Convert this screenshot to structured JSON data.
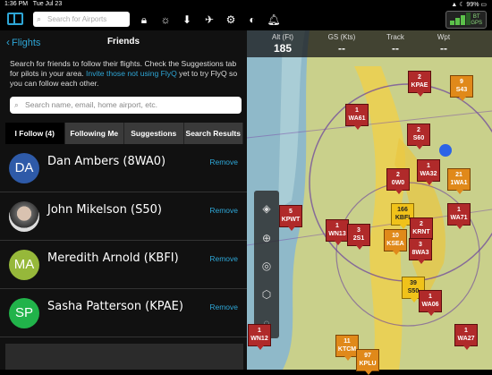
{
  "status": {
    "time": "1:36 PM",
    "date": "Tue Jul 23",
    "battery": "99%"
  },
  "toolbar": {
    "search_placeholder": "Search for Airports",
    "icons": [
      "sidebar-icon",
      "lock-icon",
      "brightness-icon",
      "download-icon",
      "airplane-icon",
      "gear-icon",
      "contrast-icon",
      "bell-icon"
    ],
    "gps_text_1": "BT",
    "gps_text_2": "GPS"
  },
  "panel": {
    "back_label": "Flights",
    "title": "Friends",
    "intro": "Search for friends to follow their flights. Check the Suggestions tab for pilots in your area.",
    "intro_link": "Invite those not using FlyQ",
    "intro_tail": "yet to try FlyQ so you can follow each other.",
    "search_placeholder": "Search name, email, home airport, etc.",
    "tabs": [
      {
        "label": "I Follow (4)",
        "active": true
      },
      {
        "label": "Following Me",
        "active": false
      },
      {
        "label": "Suggestions",
        "active": false
      },
      {
        "label": "Search Results",
        "active": false
      }
    ],
    "friends": [
      {
        "initials": "DA",
        "name": "Dan Ambers (8WA0)",
        "color": "#2e5aa8",
        "remove": "Remove"
      },
      {
        "initials": "",
        "name": "John Mikelson (S50)",
        "color": "#444",
        "remove": "Remove"
      },
      {
        "initials": "MA",
        "name": "Meredith Arnold (KBFI)",
        "color": "#96b83a",
        "remove": "Remove"
      },
      {
        "initials": "SP",
        "name": "Sasha Patterson (KPAE)",
        "color": "#21b34a",
        "remove": "Remove"
      }
    ]
  },
  "map": {
    "info": [
      {
        "label": "Alt (Ft)",
        "value": "185"
      },
      {
        "label": "GS (Kts)",
        "value": "--"
      },
      {
        "label": "Track",
        "value": "--"
      },
      {
        "label": "Wpt",
        "value": "--"
      }
    ],
    "pins": [
      {
        "top": "2",
        "bot": "KPAE",
        "cls": ""
      },
      {
        "top": "9",
        "bot": "S43",
        "cls": "or"
      },
      {
        "top": "1",
        "bot": "WA61",
        "cls": ""
      },
      {
        "top": "2",
        "bot": "S60",
        "cls": ""
      },
      {
        "top": "1",
        "bot": "WA32",
        "cls": ""
      },
      {
        "top": "2",
        "bot": "0W0",
        "cls": ""
      },
      {
        "top": "21",
        "bot": "1WA1",
        "cls": "or"
      },
      {
        "top": "5",
        "bot": "KPWT",
        "cls": ""
      },
      {
        "top": "166",
        "bot": "KBFI",
        "cls": "yl"
      },
      {
        "top": "1",
        "bot": "WA71",
        "cls": ""
      },
      {
        "top": "1",
        "bot": "WN13",
        "cls": ""
      },
      {
        "top": "3",
        "bot": "2S1",
        "cls": ""
      },
      {
        "top": "2",
        "bot": "KRNT",
        "cls": ""
      },
      {
        "top": "10",
        "bot": "KSEA",
        "cls": "or"
      },
      {
        "top": "3",
        "bot": "8WA3",
        "cls": ""
      },
      {
        "top": "39",
        "bot": "S50",
        "cls": "yl"
      },
      {
        "top": "1",
        "bot": "WA06",
        "cls": ""
      },
      {
        "top": "11",
        "bot": "KTCM",
        "cls": "or"
      },
      {
        "top": "1",
        "bot": "WA27",
        "cls": ""
      },
      {
        "top": "97",
        "bot": "KPLU",
        "cls": "or"
      },
      {
        "top": "1",
        "bot": "WN12",
        "cls": ""
      }
    ]
  }
}
